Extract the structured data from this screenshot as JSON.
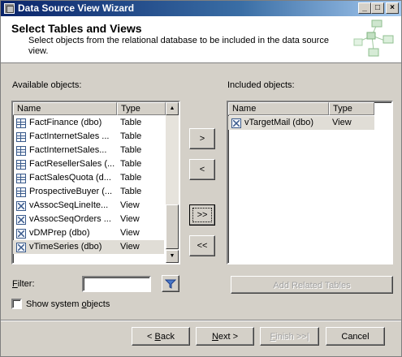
{
  "window": {
    "title": "Data Source View Wizard",
    "controls": {
      "minimize": "_",
      "maximize": "□",
      "close": "×"
    }
  },
  "header": {
    "title": "Select Tables and Views",
    "subtitle": "Select objects from the relational database to be included in the data source view."
  },
  "available": {
    "label": "Available objects:",
    "columns": {
      "name": "Name",
      "type": "Type"
    },
    "rows": [
      {
        "name": "FactFinance (dbo)",
        "type": "Table",
        "icon": "table-icon"
      },
      {
        "name": "FactInternetSales ...",
        "type": "Table",
        "icon": "table-icon"
      },
      {
        "name": "FactInternetSales...",
        "type": "Table",
        "icon": "table-icon"
      },
      {
        "name": "FactResellerSales (...",
        "type": "Table",
        "icon": "table-icon"
      },
      {
        "name": "FactSalesQuota (d...",
        "type": "Table",
        "icon": "table-icon"
      },
      {
        "name": "ProspectiveBuyer (...",
        "type": "Table",
        "icon": "table-icon"
      },
      {
        "name": "vAssocSeqLineIte...",
        "type": "View",
        "icon": "view-icon"
      },
      {
        "name": "vAssocSeqOrders ...",
        "type": "View",
        "icon": "view-icon"
      },
      {
        "name": "vDMPrep (dbo)",
        "type": "View",
        "icon": "view-icon"
      },
      {
        "name": "vTimeSeries (dbo)",
        "type": "View",
        "icon": "view-icon",
        "selected": true
      }
    ]
  },
  "included": {
    "label": "Included objects:",
    "columns": {
      "name": "Name",
      "type": "Type"
    },
    "rows": [
      {
        "name": "vTargetMail (dbo)",
        "type": "View",
        "icon": "view-icon",
        "selected": true
      }
    ]
  },
  "transfer": {
    "add": ">",
    "remove": "<",
    "add_all": ">>",
    "remove_all": "<<"
  },
  "filter": {
    "label": "Filter:",
    "value": ""
  },
  "show_system": {
    "label": "Show system objects",
    "checked": false
  },
  "add_related_label": "Add Related Tables",
  "footer": {
    "back": "< Back",
    "next": "Next >",
    "finish": "Finish >>|",
    "cancel": "Cancel"
  }
}
